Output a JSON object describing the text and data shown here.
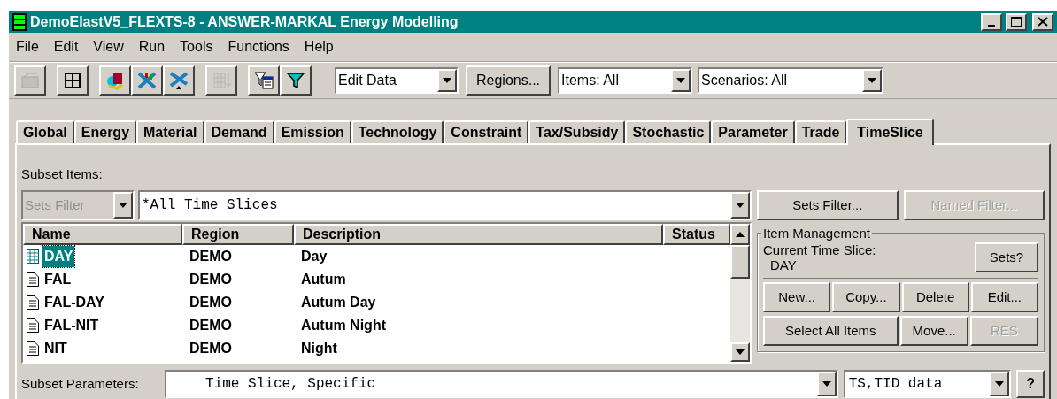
{
  "window": {
    "title": "DemoElastV5_FLEXTS-8 - ANSWER-MARKAL Energy Modelling"
  },
  "menu": [
    "File",
    "Edit",
    "View",
    "Run",
    "Tools",
    "Functions",
    "Help"
  ],
  "toolbar": {
    "icons": [
      {
        "kind": "open",
        "disabled": true
      },
      {
        "kind": "grid",
        "disabled": false
      },
      {
        "kind": "cube",
        "disabled": false
      },
      {
        "kind": "chart",
        "disabled": false
      },
      {
        "kind": "cross",
        "disabled": false
      },
      {
        "kind": "table",
        "disabled": true
      },
      {
        "kind": "filtertable",
        "disabled": false
      },
      {
        "kind": "filter",
        "disabled": false
      }
    ],
    "mode": "Edit Data",
    "regions_button": "Regions...",
    "items": "Items: All",
    "scenarios": "Scenarios: All"
  },
  "tabs": [
    {
      "label": "Global",
      "selected": false
    },
    {
      "label": "Energy",
      "selected": false
    },
    {
      "label": "Material",
      "selected": false
    },
    {
      "label": "Demand",
      "selected": false
    },
    {
      "label": "Emission",
      "selected": false
    },
    {
      "label": "Technology",
      "selected": false
    },
    {
      "label": "Constraint",
      "selected": false
    },
    {
      "label": "Tax/Subsidy",
      "selected": false
    },
    {
      "label": "Stochastic",
      "selected": false
    },
    {
      "label": "Parameter",
      "selected": false
    },
    {
      "label": "Trade",
      "selected": false
    },
    {
      "label": "TimeSlice",
      "selected": true
    }
  ],
  "subset_items": {
    "label": "Subset Items:",
    "sets_filter": {
      "placeholder": "Sets Filter",
      "disabled": true
    },
    "value": "*All Time Slices"
  },
  "filter_buttons": [
    {
      "label": "Sets Filter...",
      "disabled": false
    },
    {
      "label": "Named Filter...",
      "disabled": true
    }
  ],
  "table": {
    "columns": [
      "Name",
      "Region",
      "Description",
      "Status"
    ],
    "rows": [
      {
        "kind": "table",
        "name": "DAY",
        "region": "DEMO",
        "description": "Day",
        "selected": true
      },
      {
        "kind": "document",
        "name": "FAL",
        "region": "DEMO",
        "description": "Autum",
        "selected": false
      },
      {
        "kind": "document",
        "name": "FAL-DAY",
        "region": "DEMO",
        "description": "Autum Day",
        "selected": false
      },
      {
        "kind": "document",
        "name": "FAL-NIT",
        "region": "DEMO",
        "description": "Autum Night",
        "selected": false
      },
      {
        "kind": "document",
        "name": "NIT",
        "region": "DEMO",
        "description": "Night",
        "selected": false
      }
    ]
  },
  "item_management": {
    "title": "Item Management",
    "current_label": "Current Time Slice:",
    "current_value": "DAY",
    "sets_button": "Sets?",
    "buttons": [
      [
        {
          "label": "New...",
          "disabled": false
        },
        {
          "label": "Copy...",
          "disabled": false
        },
        {
          "label": "Delete",
          "disabled": false
        },
        {
          "label": "Edit...",
          "disabled": false
        }
      ],
      [
        {
          "label": "Select All Items",
          "disabled": false
        },
        {
          "label": "Move...",
          "disabled": false
        },
        {
          "label": "RES",
          "disabled": true
        }
      ]
    ]
  },
  "subset_parameters": {
    "label": "Subset Parameters:",
    "value": "Time Slice, Specific",
    "data": "TS,TID data",
    "help": "?"
  }
}
